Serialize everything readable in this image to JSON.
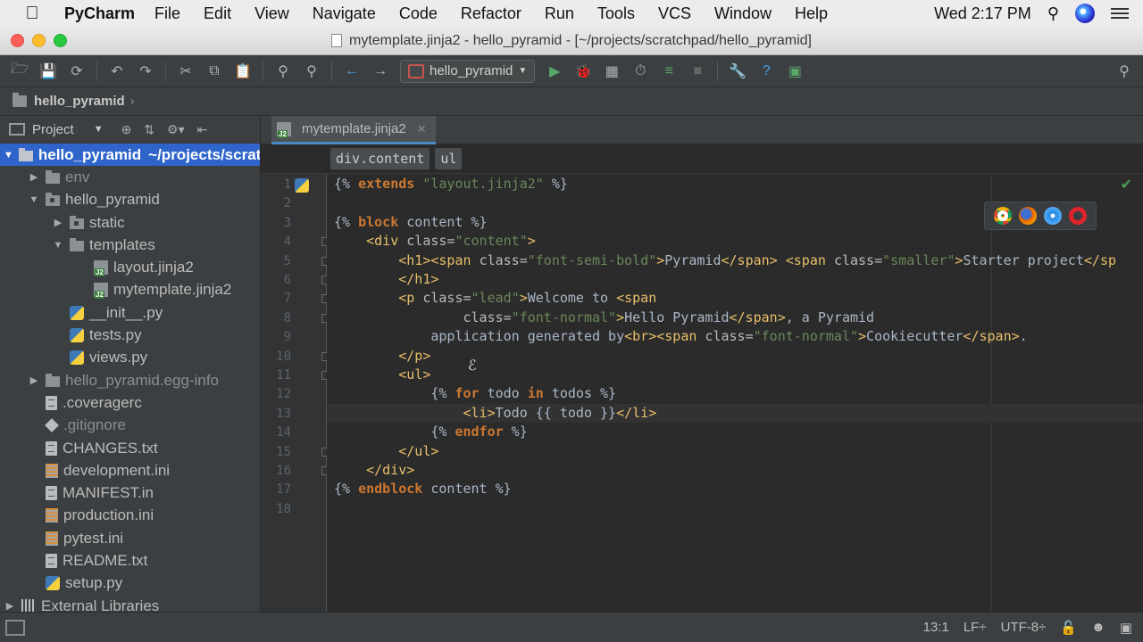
{
  "menubar": {
    "app_name": "PyCharm",
    "items": [
      "File",
      "Edit",
      "View",
      "Navigate",
      "Code",
      "Refactor",
      "Run",
      "Tools",
      "VCS",
      "Window",
      "Help"
    ],
    "clock": "Wed 2:17 PM"
  },
  "window": {
    "title": "mytemplate.jinja2 - hello_pyramid - [~/projects/scratchpad/hello_pyramid]"
  },
  "toolbar": {
    "run_config": "hello_pyramid"
  },
  "navbar": {
    "breadcrumb": "hello_pyramid"
  },
  "project_panel": {
    "title": "Project",
    "tree": [
      {
        "name": "hello_pyramid",
        "suffix": "~/projects/scratchpad/hello_pyramid",
        "icon": "folder-icon",
        "depth": 0,
        "toggle": "▼",
        "selected": true
      },
      {
        "name": "env",
        "icon": "folder-icon",
        "depth": 1,
        "toggle": "▶",
        "muted": true
      },
      {
        "name": "hello_pyramid",
        "icon": "package-folder-icon",
        "depth": 1,
        "toggle": "▼"
      },
      {
        "name": "static",
        "icon": "package-folder-icon",
        "depth": 2,
        "toggle": "▶"
      },
      {
        "name": "templates",
        "icon": "folder-icon",
        "depth": 2,
        "toggle": "▼"
      },
      {
        "name": "layout.jinja2",
        "icon": "jinja-file-icon",
        "depth": 3
      },
      {
        "name": "mytemplate.jinja2",
        "icon": "jinja-file-icon",
        "depth": 3
      },
      {
        "name": "__init__.py",
        "icon": "python-file-icon",
        "depth": 2
      },
      {
        "name": "tests.py",
        "icon": "python-file-icon",
        "depth": 2
      },
      {
        "name": "views.py",
        "icon": "python-file-icon",
        "depth": 2
      },
      {
        "name": "hello_pyramid.egg-info",
        "icon": "folder-icon",
        "depth": 1,
        "toggle": "▶",
        "muted": true
      },
      {
        "name": ".coveragerc",
        "icon": "text-file-icon",
        "depth": 1
      },
      {
        "name": ".gitignore",
        "icon": "git-file-icon",
        "depth": 1,
        "muted": true
      },
      {
        "name": "CHANGES.txt",
        "icon": "text-file-icon",
        "depth": 1
      },
      {
        "name": "development.ini",
        "icon": "ini-file-icon",
        "depth": 1
      },
      {
        "name": "MANIFEST.in",
        "icon": "text-file-icon",
        "depth": 1
      },
      {
        "name": "production.ini",
        "icon": "ini-file-icon",
        "depth": 1
      },
      {
        "name": "pytest.ini",
        "icon": "ini-file-icon",
        "depth": 1
      },
      {
        "name": "README.txt",
        "icon": "text-file-icon",
        "depth": 1
      },
      {
        "name": "setup.py",
        "icon": "python-file-icon",
        "depth": 1
      },
      {
        "name": "External Libraries",
        "icon": "library-icon",
        "depth": 0,
        "toggle": "▶"
      }
    ]
  },
  "editor": {
    "tab_label": "mytemplate.jinja2",
    "crumbs": [
      "div.content",
      "ul"
    ],
    "current_line": 13,
    "lines": [
      [
        [
          "tplp",
          "{% "
        ],
        [
          "tpl",
          "extends"
        ],
        [
          "str",
          " \"layout.jinja2\""
        ],
        [
          "tplp",
          " %}"
        ]
      ],
      [],
      [
        [
          "tplp",
          "{% "
        ],
        [
          "tpl",
          "block"
        ],
        [
          "txt",
          " content "
        ],
        [
          "tplp",
          "%}"
        ]
      ],
      [
        [
          "txt",
          "    "
        ],
        [
          "tag",
          "<div "
        ],
        [
          "attr",
          "class="
        ],
        [
          "str",
          "\"content\""
        ],
        [
          "tag",
          ">"
        ]
      ],
      [
        [
          "txt",
          "        "
        ],
        [
          "tag",
          "<h1><span "
        ],
        [
          "attr",
          "class="
        ],
        [
          "str",
          "\"font-semi-bold\""
        ],
        [
          "tag",
          ">"
        ],
        [
          "txt",
          "Pyramid"
        ],
        [
          "tag",
          "</span> <span "
        ],
        [
          "attr",
          "class="
        ],
        [
          "str",
          "\"smaller\""
        ],
        [
          "tag",
          ">"
        ],
        [
          "txt",
          "Starter project"
        ],
        [
          "tag",
          "</sp"
        ]
      ],
      [
        [
          "txt",
          "        "
        ],
        [
          "tag",
          "</h1>"
        ]
      ],
      [
        [
          "txt",
          "        "
        ],
        [
          "tag",
          "<p "
        ],
        [
          "attr",
          "class="
        ],
        [
          "str",
          "\"lead\""
        ],
        [
          "tag",
          ">"
        ],
        [
          "txt",
          "Welcome to "
        ],
        [
          "tag",
          "<span"
        ]
      ],
      [
        [
          "txt",
          "                "
        ],
        [
          "attr",
          "class="
        ],
        [
          "str",
          "\"font-normal\""
        ],
        [
          "tag",
          ">"
        ],
        [
          "txt",
          "Hello Pyramid"
        ],
        [
          "tag",
          "</span>"
        ],
        [
          "txt",
          ", a Pyramid"
        ]
      ],
      [
        [
          "txt",
          "            application generated by"
        ],
        [
          "tag",
          "<br><span "
        ],
        [
          "attr",
          "class="
        ],
        [
          "str",
          "\"font-normal\""
        ],
        [
          "tag",
          ">"
        ],
        [
          "txt",
          "Cookiecutter"
        ],
        [
          "tag",
          "</span>"
        ],
        [
          "txt",
          "."
        ]
      ],
      [
        [
          "txt",
          "        "
        ],
        [
          "tag",
          "</p>"
        ]
      ],
      [
        [
          "txt",
          "        "
        ],
        [
          "tag",
          "<ul>"
        ]
      ],
      [
        [
          "txt",
          "            "
        ],
        [
          "tplp",
          "{% "
        ],
        [
          "tpl",
          "for"
        ],
        [
          "txt",
          " todo "
        ],
        [
          "tpl",
          "in"
        ],
        [
          "txt",
          " todos "
        ],
        [
          "tplp",
          "%}"
        ]
      ],
      [
        [
          "txt",
          "                "
        ],
        [
          "tag",
          "<li>"
        ],
        [
          "txt",
          "Todo {{ todo }}"
        ],
        [
          "tag",
          "</li>"
        ]
      ],
      [
        [
          "txt",
          "            "
        ],
        [
          "tplp",
          "{% "
        ],
        [
          "tpl",
          "endfor"
        ],
        [
          "tplp",
          " %}"
        ]
      ],
      [
        [
          "txt",
          "        "
        ],
        [
          "tag",
          "</ul>"
        ]
      ],
      [
        [
          "txt",
          "    "
        ],
        [
          "tag",
          "</div>"
        ]
      ],
      [
        [
          "tplp",
          "{% "
        ],
        [
          "tpl",
          "endblock"
        ],
        [
          "txt",
          " content "
        ],
        [
          "tplp",
          "%}"
        ]
      ],
      []
    ]
  },
  "statusbar": {
    "position": "13:1",
    "line_sep": "LF÷",
    "encoding": "UTF-8÷"
  }
}
